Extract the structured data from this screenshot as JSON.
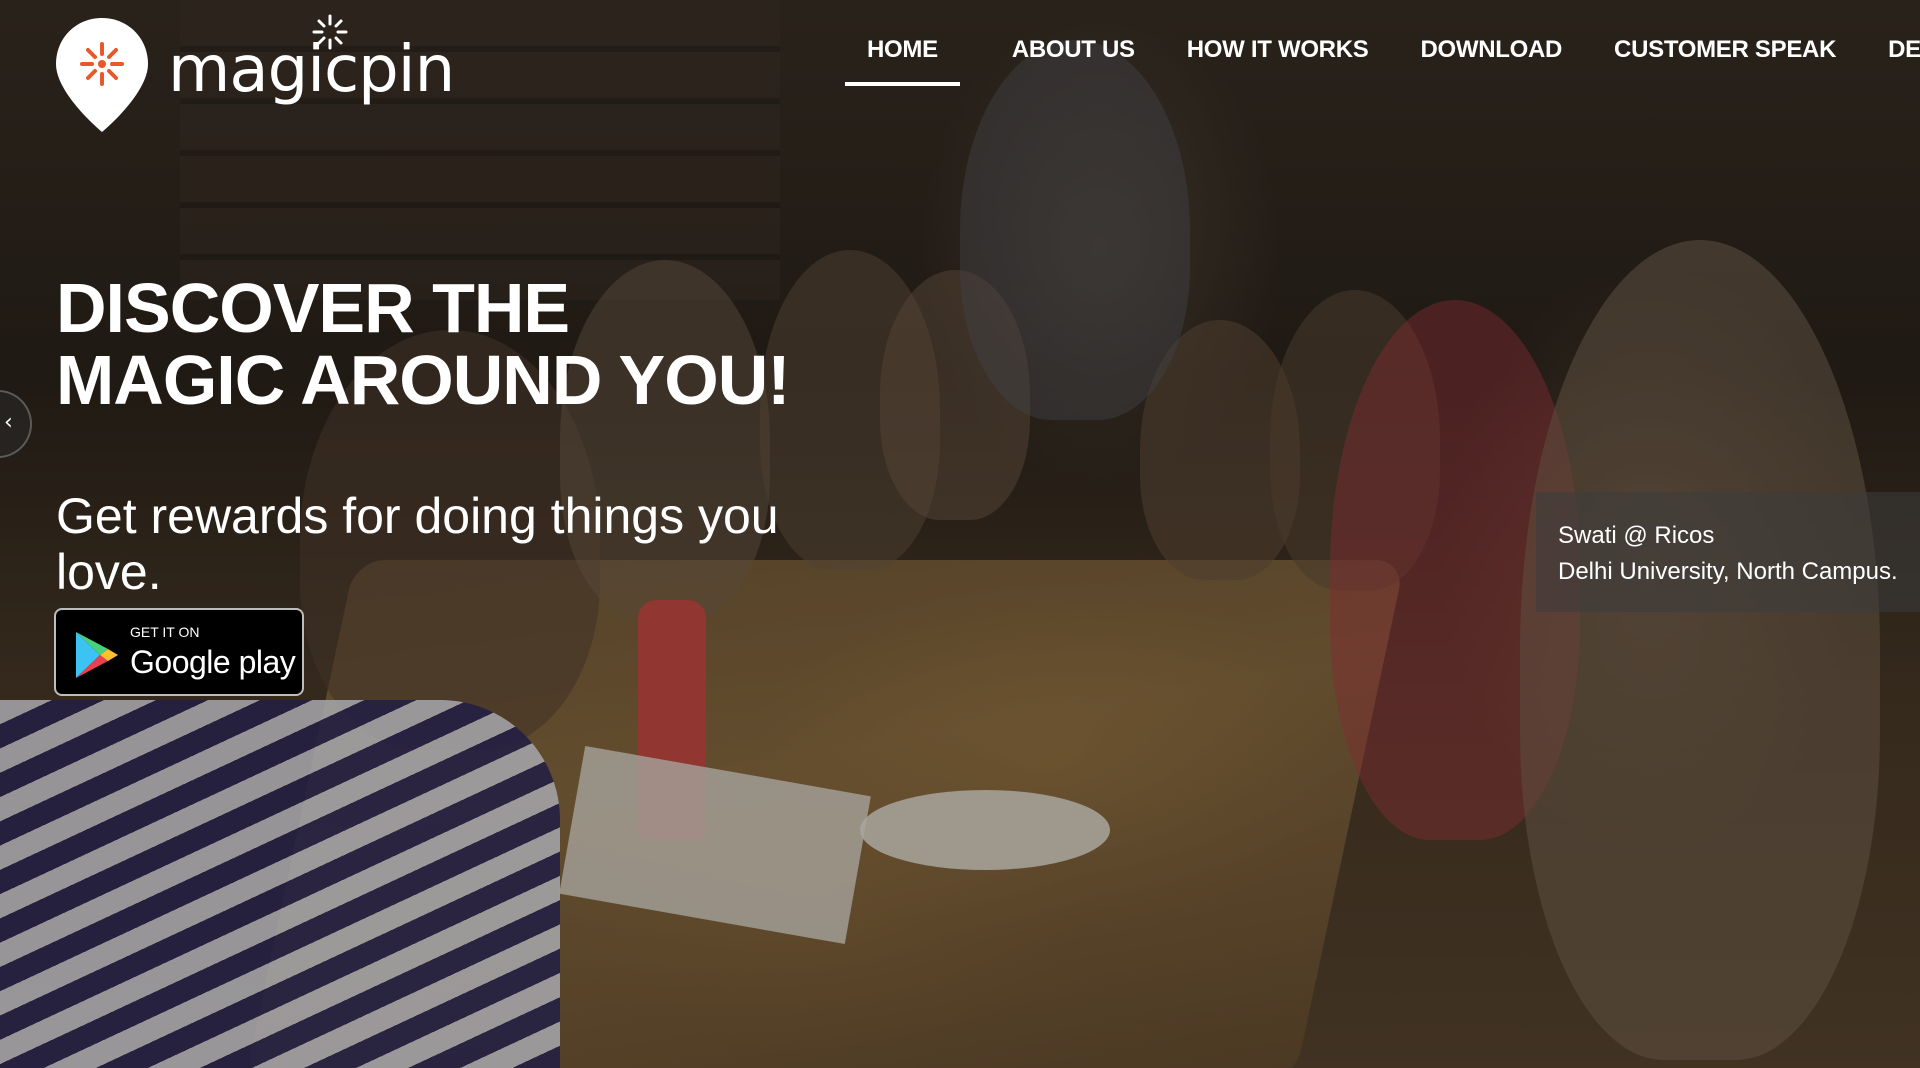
{
  "header": {
    "logo_text": "magicpin",
    "nav": [
      {
        "label": "HOME",
        "active": true
      },
      {
        "label": "ABOUT US",
        "active": false
      },
      {
        "label": "HOW IT WORKS",
        "active": false
      },
      {
        "label": "DOWNLOAD",
        "active": false
      },
      {
        "label": "CUSTOMER SPEAK",
        "active": false
      },
      {
        "label": "DEAL",
        "active": false
      }
    ]
  },
  "hero": {
    "headline_line1": "DISCOVER THE",
    "headline_line2": "MAGIC AROUND YOU!",
    "subline": "Get rewards for doing things you love.",
    "store_badge": {
      "small_text": "GET IT ON",
      "big_text": "Google play"
    },
    "caption_line1": "Swati @ Ricos",
    "caption_line2": "Delhi University, North Campus."
  },
  "colors": {
    "logo_accent": "#e9572b",
    "text": "#ffffff"
  },
  "icons": {
    "prev_arrow": "chevron-left-icon",
    "logo": "map-pin-icon",
    "store": "google-play-icon"
  }
}
